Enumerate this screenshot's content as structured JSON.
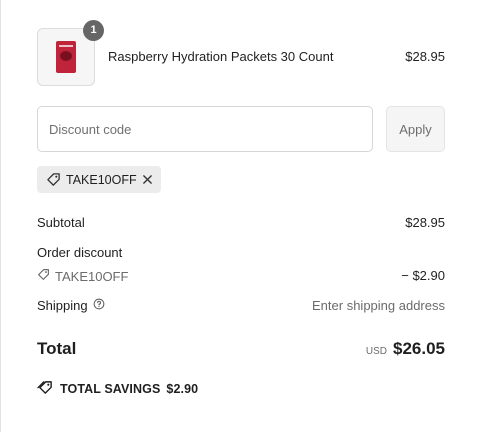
{
  "product": {
    "name": "Raspberry Hydration Packets 30 Count",
    "price": "$28.95",
    "quantity": "1",
    "image_icon": "product-thumbnail"
  },
  "discount": {
    "placeholder": "Discount code",
    "apply_label": "Apply",
    "applied_code": "TAKE10OFF"
  },
  "summary": {
    "subtotal_label": "Subtotal",
    "subtotal_value": "$28.95",
    "order_discount_label": "Order discount",
    "discount_code": "TAKE10OFF",
    "discount_value": "− $2.90",
    "shipping_label": "Shipping",
    "shipping_value": "Enter shipping address"
  },
  "total": {
    "label": "Total",
    "currency": "USD",
    "amount": "$26.05"
  },
  "savings": {
    "label": "TOTAL SAVINGS",
    "amount": "$2.90"
  },
  "colors": {
    "accent_badge": "#666666",
    "chip_bg": "#ececec",
    "muted_text": "#6b6b6b"
  }
}
